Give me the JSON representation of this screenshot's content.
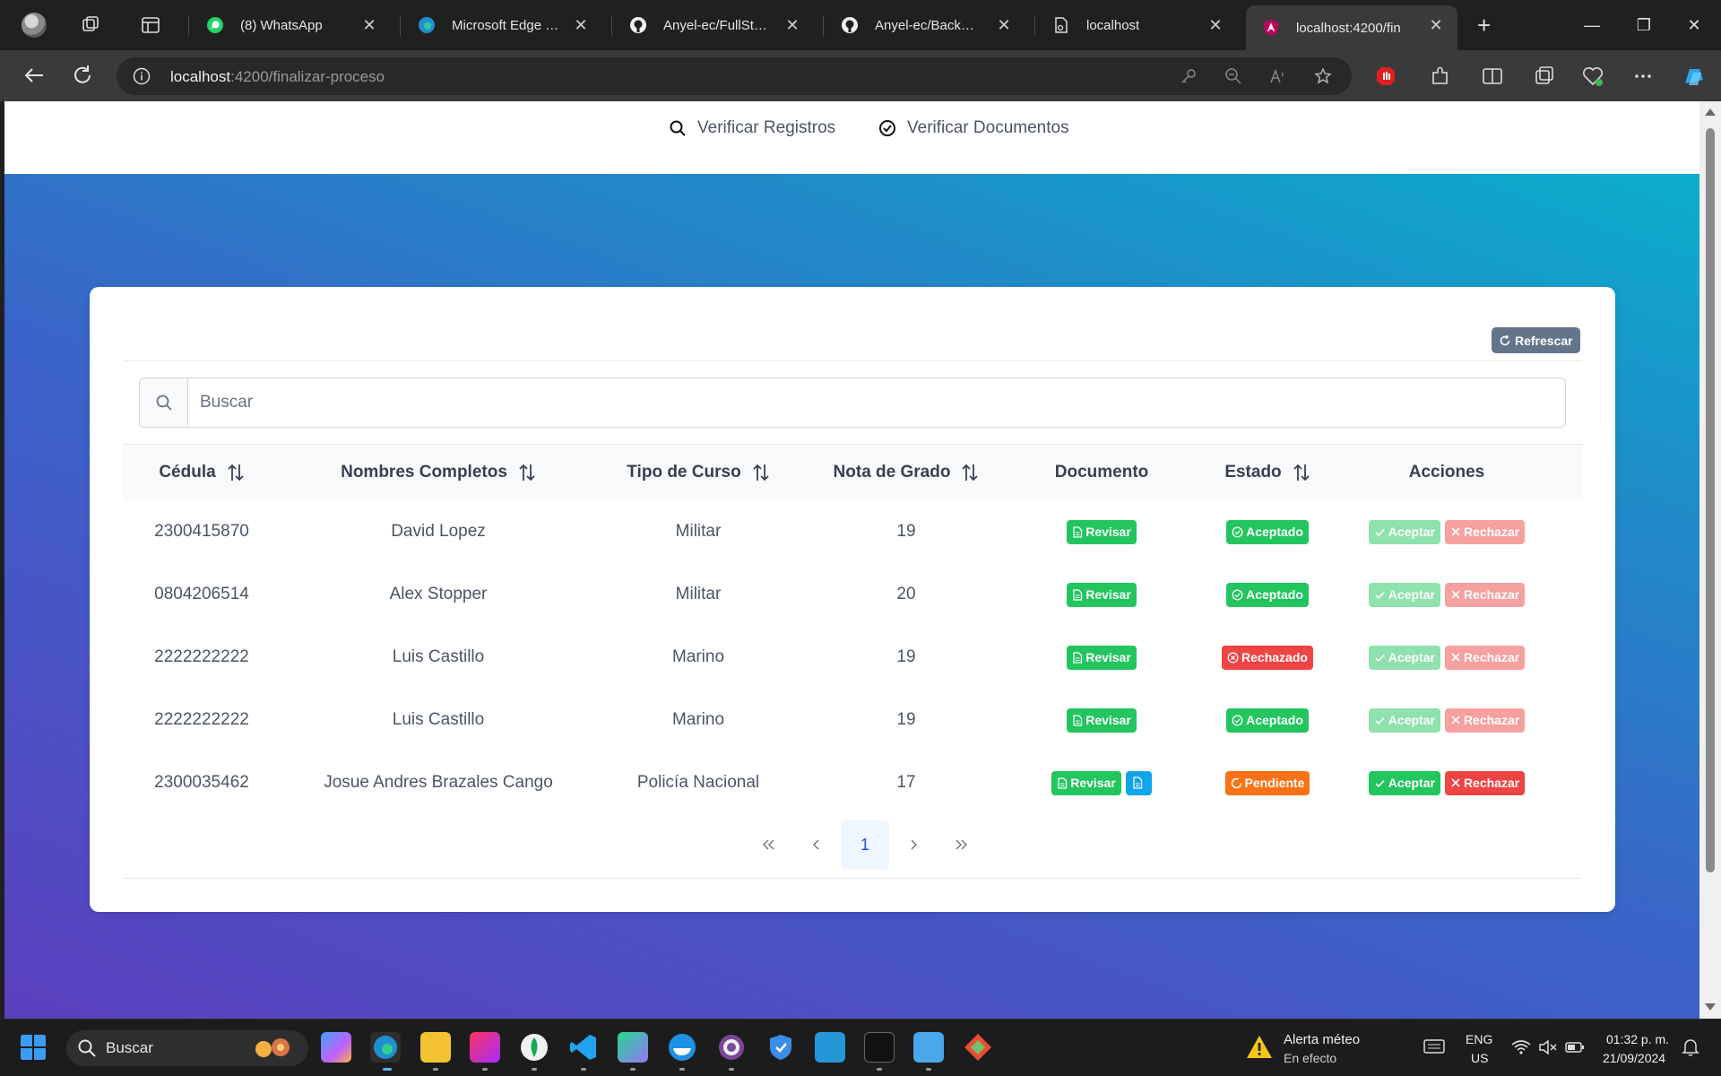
{
  "browser": {
    "tabs": [
      {
        "title": "(8) WhatsApp",
        "favicon": "whatsapp-icon",
        "active": false
      },
      {
        "title": "Microsoft Edge | N",
        "favicon": "edge-icon",
        "active": false
      },
      {
        "title": "Anyel-ec/FullStack",
        "favicon": "github-icon",
        "active": false
      },
      {
        "title": "Anyel-ec/BackEnd",
        "favicon": "github-icon",
        "active": false
      },
      {
        "title": "localhost",
        "favicon": "page-icon",
        "active": false
      },
      {
        "title": "localhost:4200/fin",
        "favicon": "angular-icon",
        "active": true
      }
    ],
    "url_host": "localhost",
    "url_rest": ":4200/finalizar-proceso"
  },
  "nav": {
    "verificar_registros": "Verificar Registros",
    "verificar_documentos": "Verificar Documentos"
  },
  "toolbar": {
    "refresh_label": "Refrescar"
  },
  "search": {
    "placeholder": "Buscar"
  },
  "table": {
    "columns": [
      "Cédula",
      "Nombres Completos",
      "Tipo de Curso",
      "Nota de Grado",
      "Documento",
      "Estado",
      "Acciones"
    ],
    "rows": [
      {
        "cedula": "2300415870",
        "nombre": "David Lopez",
        "curso": "Militar",
        "nota": "19",
        "estado": "Aceptado"
      },
      {
        "cedula": "0804206514",
        "nombre": "Alex Stopper",
        "curso": "Militar",
        "nota": "20",
        "estado": "Aceptado"
      },
      {
        "cedula": "2222222222",
        "nombre": "Luis Castillo",
        "curso": "Marino",
        "nota": "19",
        "estado": "Rechazado"
      },
      {
        "cedula": "2222222222",
        "nombre": "Luis Castillo",
        "curso": "Marino",
        "nota": "19",
        "estado": "Aceptado"
      },
      {
        "cedula": "2300035462",
        "nombre": "Josue Andres Brazales Cango",
        "curso": "Policía Nacional",
        "nota": "17",
        "estado": "Pendiente"
      }
    ],
    "revisar_label": "Revisar",
    "aceptar_label": "Aceptar",
    "rechazar_label": "Rechazar"
  },
  "pagination": {
    "current_page": "1"
  },
  "taskbar": {
    "search_placeholder": "Buscar",
    "weather_title": "Alerta méteo",
    "weather_subtitle": "En efecto",
    "lang_top": "ENG",
    "lang_bottom": "US",
    "time": "01:32 p. m.",
    "date": "21/09/2024"
  },
  "colors": {
    "success": "#22c55e",
    "danger": "#ef4444",
    "warning": "#f97316",
    "info": "#0ea5e9",
    "secondary": "#64748b"
  }
}
